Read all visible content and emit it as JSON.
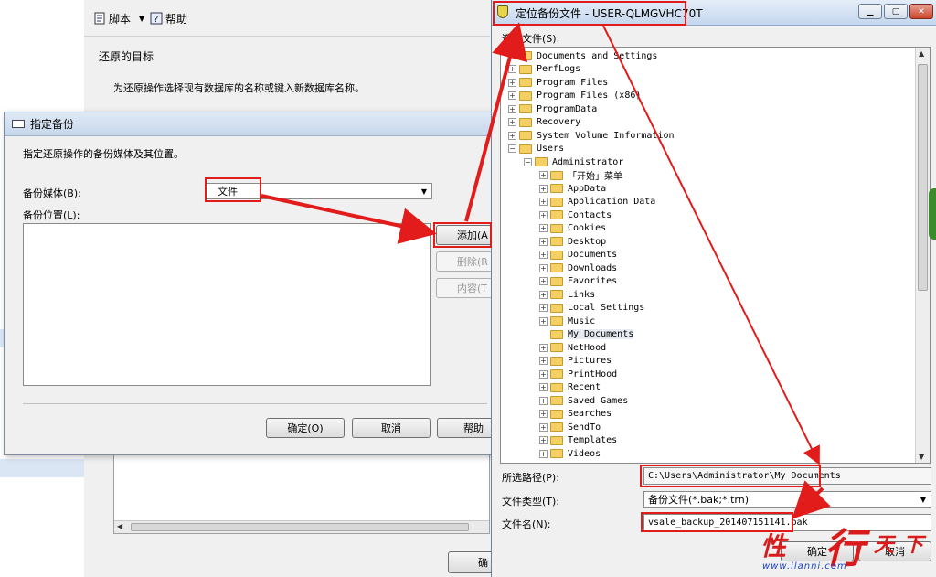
{
  "toolbar": {
    "script_label": "脚本",
    "help_label": "帮助"
  },
  "restore": {
    "section_title": "还原的目标",
    "description": "为还原操作选择现有数据库的名称或键入新数据库名称。",
    "ok_partial": "确"
  },
  "specify_backup": {
    "title": "指定备份",
    "instruction": "指定还原操作的备份媒体及其位置。",
    "media_label": "备份媒体(B):",
    "media_value": "文件",
    "location_label": "备份位置(L):",
    "add_button": "添加(A",
    "remove_button": "删除(R",
    "contents_button": "内容(T",
    "ok_button": "确定(O)",
    "cancel_button": "取消",
    "help_button": "帮助"
  },
  "locate_file": {
    "title": "定位备份文件 - USER-QLMGVHC70T",
    "select_file_label": "选择文件(S):",
    "tree": [
      {
        "label": "Documents and Settings",
        "indent": 1,
        "expander": "none"
      },
      {
        "label": "PerfLogs",
        "indent": 1,
        "expander": "plus"
      },
      {
        "label": "Program Files",
        "indent": 1,
        "expander": "plus"
      },
      {
        "label": "Program Files (x86)",
        "indent": 1,
        "expander": "plus"
      },
      {
        "label": "ProgramData",
        "indent": 1,
        "expander": "plus"
      },
      {
        "label": "Recovery",
        "indent": 1,
        "expander": "plus"
      },
      {
        "label": "System Volume Information",
        "indent": 1,
        "expander": "plus"
      },
      {
        "label": "Users",
        "indent": 1,
        "expander": "minus"
      },
      {
        "label": "Administrator",
        "indent": 2,
        "expander": "minus"
      },
      {
        "label": "「开始」菜单",
        "indent": 3,
        "expander": "plus"
      },
      {
        "label": "AppData",
        "indent": 3,
        "expander": "plus"
      },
      {
        "label": "Application Data",
        "indent": 3,
        "expander": "plus"
      },
      {
        "label": "Contacts",
        "indent": 3,
        "expander": "plus"
      },
      {
        "label": "Cookies",
        "indent": 3,
        "expander": "plus"
      },
      {
        "label": "Desktop",
        "indent": 3,
        "expander": "plus"
      },
      {
        "label": "Documents",
        "indent": 3,
        "expander": "plus"
      },
      {
        "label": "Downloads",
        "indent": 3,
        "expander": "plus"
      },
      {
        "label": "Favorites",
        "indent": 3,
        "expander": "plus"
      },
      {
        "label": "Links",
        "indent": 3,
        "expander": "plus"
      },
      {
        "label": "Local Settings",
        "indent": 3,
        "expander": "plus"
      },
      {
        "label": "Music",
        "indent": 3,
        "expander": "plus"
      },
      {
        "label": "My Documents",
        "indent": 3,
        "expander": "none",
        "selected": true
      },
      {
        "label": "NetHood",
        "indent": 3,
        "expander": "plus"
      },
      {
        "label": "Pictures",
        "indent": 3,
        "expander": "plus"
      },
      {
        "label": "PrintHood",
        "indent": 3,
        "expander": "plus"
      },
      {
        "label": "Recent",
        "indent": 3,
        "expander": "plus"
      },
      {
        "label": "Saved Games",
        "indent": 3,
        "expander": "plus"
      },
      {
        "label": "Searches",
        "indent": 3,
        "expander": "plus"
      },
      {
        "label": "SendTo",
        "indent": 3,
        "expander": "plus"
      },
      {
        "label": "Templates",
        "indent": 3,
        "expander": "plus"
      },
      {
        "label": "Videos",
        "indent": 3,
        "expander": "plus"
      }
    ],
    "path_label": "所选路径(P):",
    "path_value": "C:\\Users\\Administrator\\My Documents",
    "filetype_label": "文件类型(T):",
    "filetype_value": "备份文件(*.bak;*.trn)",
    "filename_label": "文件名(N):",
    "filename_value": "vsale_backup_201407151141.bak",
    "ok_button": "确定",
    "cancel_button": "取消"
  },
  "watermark": {
    "chars": [
      "性",
      "行",
      "天",
      "下"
    ],
    "url": "www.ilanni.com"
  },
  "colors": {
    "annotation": "#e21b1b",
    "folder": "#f4cf63"
  }
}
